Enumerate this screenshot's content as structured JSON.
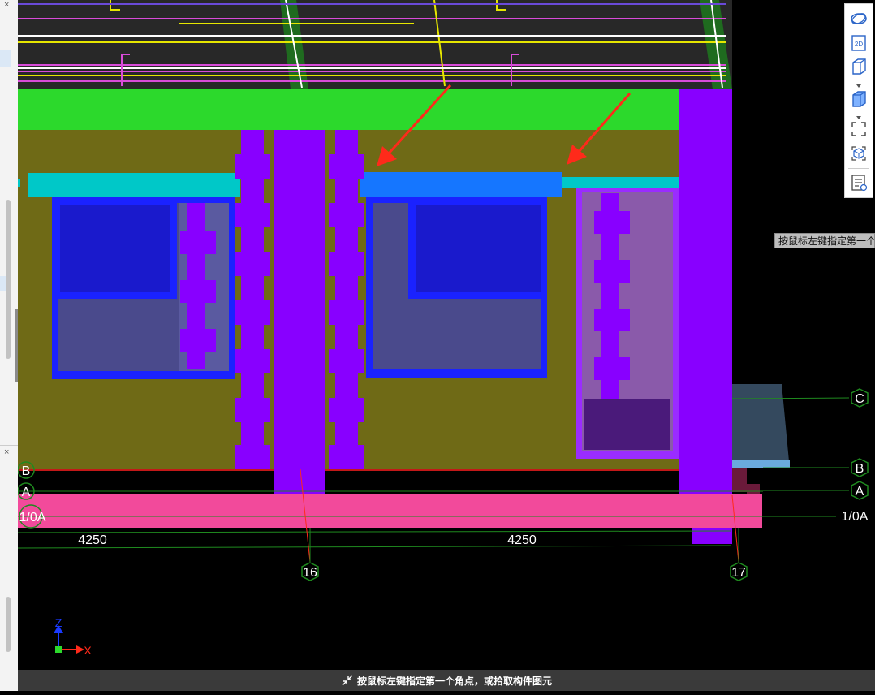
{
  "tooltip": "按鼠标左键指定第一个",
  "status_bar": {
    "message": "按鼠标左键指定第一个角点，或拾取构件图元"
  },
  "grid_labels": {
    "axis_16": "16",
    "axis_17": "17",
    "row_c": "C",
    "row_b": "B",
    "row_a": "A",
    "row_10a": "1/0A",
    "dim_left": "4250",
    "dim_right": "4250"
  },
  "axes": {
    "z": "Z",
    "x": "X"
  },
  "toolbar": {
    "buttons": [
      "display-mode-icon",
      "2d-view-icon",
      "3d-view-icon",
      "box-view-icon",
      "fit-view-icon",
      "component-view-icon",
      "properties-list-icon"
    ],
    "view_2d_label": "2D"
  },
  "colors": {
    "wall": "#6f6a16",
    "beam_green": "#2cd92c",
    "column_purple": "#8800ff",
    "lintel_cyan": "#00c8c8",
    "lintel_blue": "#1576ff",
    "window_frame": "#1a22ff",
    "slab_pink": "#f24a9b",
    "annotation_red": "#ff2a1a"
  }
}
